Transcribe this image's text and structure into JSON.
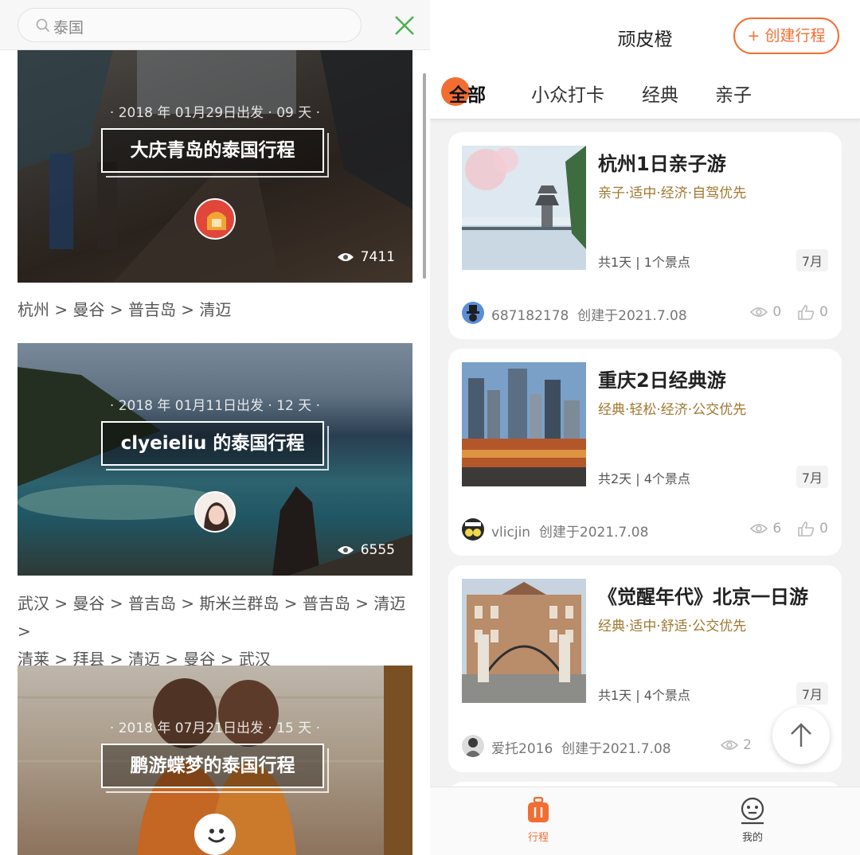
{
  "search": {
    "query": "泰国"
  },
  "trips": [
    {
      "date": "· 2018 年 01月29日出发 · 09 天 ·",
      "title": "大庆青岛的泰国行程",
      "views": "7411",
      "route": "杭州 > 曼谷 > 普吉岛 > 清迈"
    },
    {
      "date": "· 2018 年 01月11日出发 · 12 天 ·",
      "title": "clyeieliu 的泰国行程",
      "views": "6555",
      "route_line1": "武汉 > 曼谷 > 普吉岛 > 斯米兰群岛 > 普吉岛 > 清迈 >",
      "route_line2": "清莱 > 拜县 > 清迈 > 曼谷 > 武汉"
    },
    {
      "date": "· 2018 年 07月21日出发 · 15 天 ·",
      "title": "鹏游蝶梦的泰国行程"
    }
  ],
  "header": {
    "title": "顽皮橙",
    "create_label": "+ 创建行程"
  },
  "tabs": [
    {
      "label": "全部",
      "active": true
    },
    {
      "label": "小众打卡"
    },
    {
      "label": "经典"
    },
    {
      "label": "亲子"
    }
  ],
  "itineraries": [
    {
      "title": "杭州1日亲子游",
      "tags": "亲子·适中·经济·自驾优先",
      "info": "共1天 | 1个景点",
      "month": "7月",
      "user": "687182178",
      "created": "创建于2021.7.08",
      "views": "0",
      "likes": "0"
    },
    {
      "title": "重庆2日经典游",
      "tags": "经典·轻松·经济·公交优先",
      "info": "共2天 | 4个景点",
      "month": "7月",
      "user": "vlicjin",
      "created": "创建于2021.7.08",
      "views": "6",
      "likes": "0"
    },
    {
      "title": "《觉醒年代》北京一日游",
      "tags": "经典·适中·舒适·公交优先",
      "info": "共1天 | 4个景点",
      "month": "7月",
      "user": "爱托2016",
      "created": "创建于2021.7.08",
      "views": "2"
    }
  ],
  "bottom_nav": [
    {
      "label": "行程",
      "icon": "luggage-icon",
      "active": true
    },
    {
      "label": "我的",
      "icon": "profile-face-icon"
    }
  ],
  "colors": {
    "accent": "#f26d32",
    "tag": "#a0772f",
    "close": "#4caf50"
  }
}
